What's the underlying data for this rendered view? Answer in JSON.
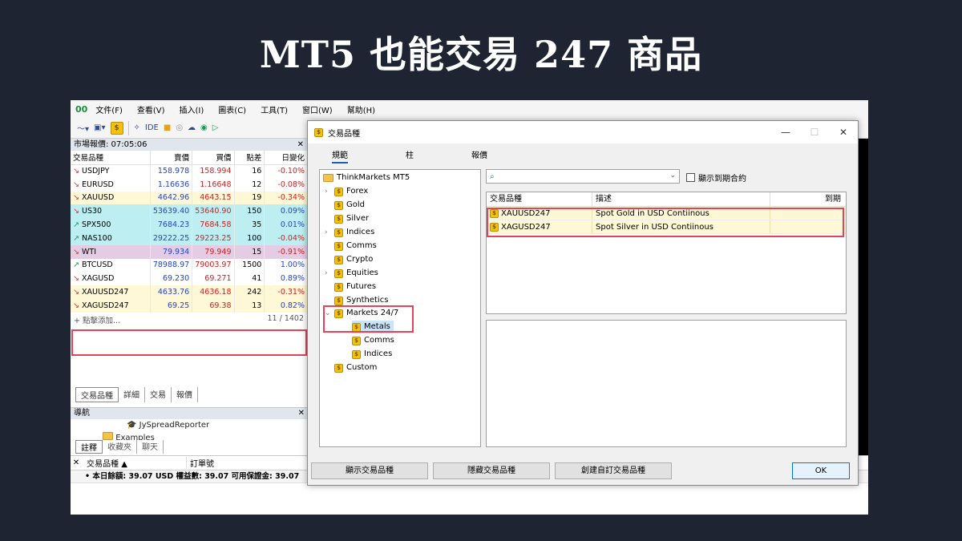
{
  "slide": {
    "title": "MT5 也能交易 247 商品"
  },
  "mt5": {
    "logo": "00",
    "menu": [
      "文件(F)",
      "查看(V)",
      "插入(I)",
      "圖表(C)",
      "工具(T)",
      "窗口(W)",
      "幫助(H)"
    ],
    "toolbar": {
      "ide_label": "IDE",
      "dollar": "$"
    },
    "market_watch": {
      "title": "市場報價: 07:05:06",
      "columns": [
        "交易品種",
        "賣價",
        "買價",
        "點差",
        "日變化"
      ],
      "rows": [
        {
          "sym": "USDJPY",
          "dir": "down",
          "bid": "158.978",
          "ask": "158.994",
          "spread": "16",
          "chg": "-0.10%",
          "bg": "#ffffff"
        },
        {
          "sym": "EURUSD",
          "dir": "down",
          "bid": "1.16636",
          "ask": "1.16648",
          "spread": "12",
          "chg": "-0.08%",
          "bg": "#ffffff"
        },
        {
          "sym": "XAUUSD",
          "dir": "down",
          "bid": "4642.96",
          "ask": "4643.15",
          "spread": "19",
          "chg": "-0.34%",
          "bg": "#fff8d6"
        },
        {
          "sym": "US30",
          "dir": "down",
          "bid": "53639.40",
          "ask": "53640.90",
          "spread": "150",
          "chg": "0.09%",
          "bg": "#bdeff2"
        },
        {
          "sym": "SPX500",
          "dir": "up",
          "bid": "7684.23",
          "ask": "7684.58",
          "spread": "35",
          "chg": "0.01%",
          "bg": "#bdeff2"
        },
        {
          "sym": "NAS100",
          "dir": "up",
          "bid": "29222.25",
          "ask": "29223.25",
          "spread": "100",
          "chg": "-0.04%",
          "bg": "#bdeff2"
        },
        {
          "sym": "WTI",
          "dir": "down",
          "bid": "79.934",
          "ask": "79.949",
          "spread": "15",
          "chg": "-0.91%",
          "bg": "#e4cde4"
        },
        {
          "sym": "BTCUSD",
          "dir": "up",
          "bid": "78988.97",
          "ask": "79003.97",
          "spread": "1500",
          "chg": "1.00%",
          "bg": "#ffffff"
        },
        {
          "sym": "XAGUSD",
          "dir": "down",
          "bid": "69.230",
          "ask": "69.271",
          "spread": "41",
          "chg": "0.89%",
          "bg": "#ffffff"
        },
        {
          "sym": "XAUUSD247",
          "dir": "down",
          "bid": "4633.76",
          "ask": "4636.18",
          "spread": "242",
          "chg": "-0.31%",
          "bg": "#fff8d6"
        },
        {
          "sym": "XAGUSD247",
          "dir": "down",
          "bid": "69.25",
          "ask": "69.38",
          "spread": "13",
          "chg": "0.82%",
          "bg": "#fff8d6"
        }
      ],
      "add_label": "+ 點擊添加...",
      "count": "11 / 1402",
      "tabs": [
        "交易品種",
        "詳細",
        "交易",
        "報價"
      ]
    },
    "navigator": {
      "title": "導航",
      "items": [
        "JySpreadReporter",
        "Examples"
      ],
      "tabs": [
        "註釋",
        "收藏夾",
        "聊天"
      ]
    },
    "toolbox": {
      "col_symbol": "交易品種",
      "col_order": "訂單號",
      "balance": "• 本日餘額: 39.07 USD  權益數: 39.07  可用保證金: 39.07"
    }
  },
  "dialog": {
    "title": "交易品種",
    "tabs": [
      "規範",
      "柱",
      "報價"
    ],
    "tree": {
      "root": "ThinkMarkets MT5",
      "items": [
        "Forex",
        "Gold",
        "Silver",
        "Indices",
        "Comms",
        "Crypto",
        "Equities",
        "Futures",
        "Synthetics",
        "Markets 24/7",
        "Metals",
        "Comms",
        "Indices",
        "Custom"
      ]
    },
    "search_placeholder": "",
    "show_expired": "顯示到期合約",
    "table": {
      "columns": [
        "交易品種",
        "描述",
        "到期"
      ],
      "rows": [
        {
          "sym": "XAUUSD247",
          "desc": "Spot Gold in USD Contiinous",
          "exp": ""
        },
        {
          "sym": "XAGUSD247",
          "desc": "Spot Silver in USD Contiinous",
          "exp": ""
        }
      ]
    },
    "buttons": {
      "show": "顯示交易品種",
      "hide": "隱藏交易品種",
      "create": "創建自訂交易品種",
      "ok": "OK"
    }
  }
}
